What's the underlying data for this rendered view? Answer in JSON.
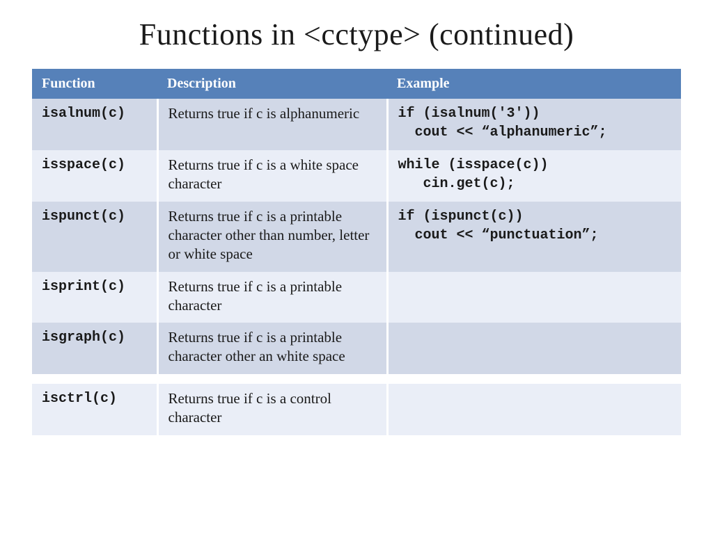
{
  "title": "Functions in <cctype> (continued)",
  "headers": {
    "c0": "Function",
    "c1": "Description",
    "c2": "Example"
  },
  "rows": [
    {
      "func": "isalnum(c)",
      "desc": "Returns true if c is alphanumeric",
      "example": "if (isalnum('3'))\n  cout << “alphanumeric”;"
    },
    {
      "func": "isspace(c)",
      "desc": "Returns true if c is a white space character",
      "example": "while (isspace(c))\n   cin.get(c);"
    },
    {
      "func": "ispunct(c)",
      "desc": "Returns true if c is a printable character other than number, letter or white space",
      "example": "if (ispunct(c))\n  cout << “punctuation”;"
    },
    {
      "func": "isprint(c)",
      "desc": "Returns true if c is a printable character",
      "example": ""
    },
    {
      "func": "isgraph(c)",
      "desc": "Returns true if c is a printable character other an white space",
      "example": ""
    },
    {
      "func": "isctrl(c)",
      "desc": "Returns true if c is a control character",
      "example": ""
    }
  ]
}
